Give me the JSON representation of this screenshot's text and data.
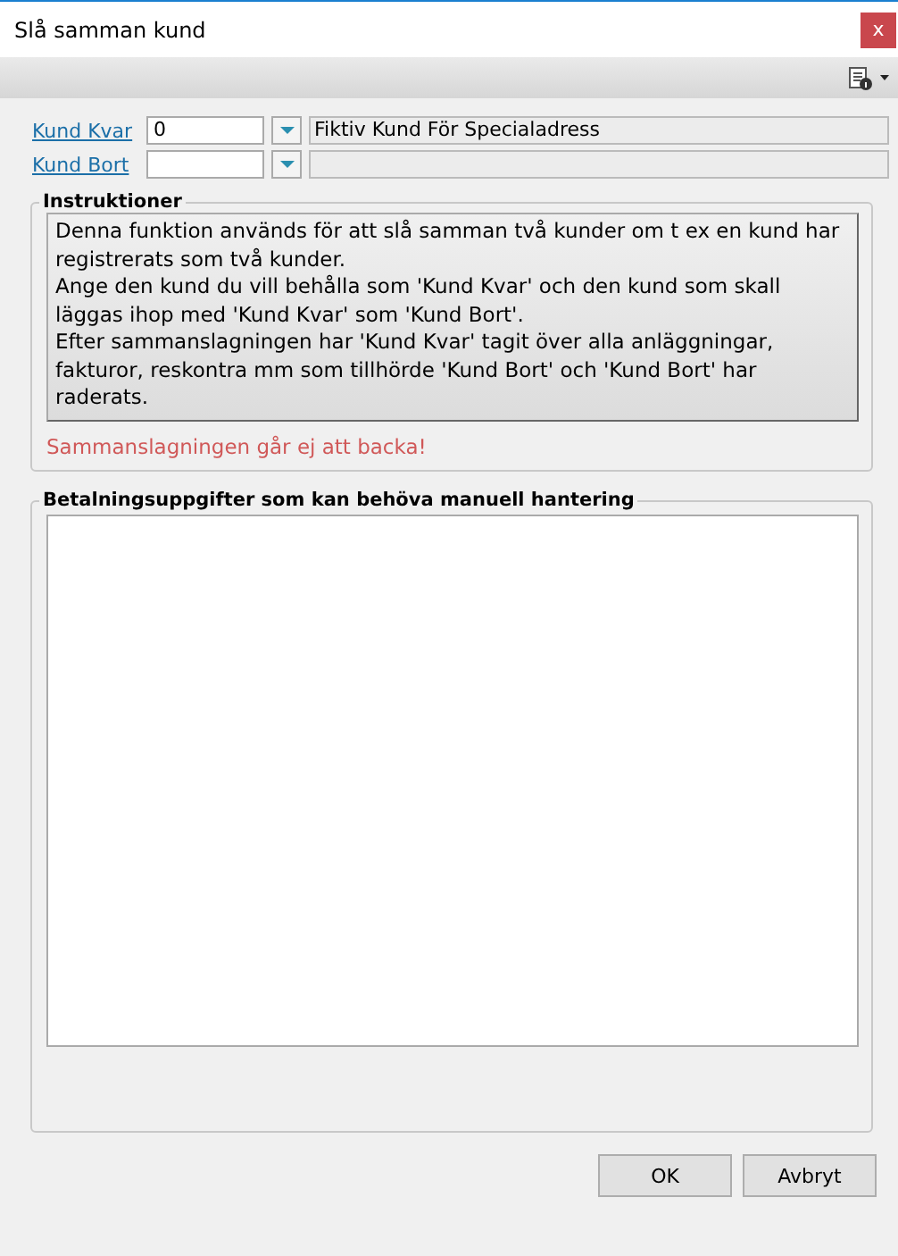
{
  "window": {
    "title": "Slå samman kund",
    "close": "x"
  },
  "fields": [
    {
      "label": "Kund Kvar",
      "value": "0",
      "name": "Fiktiv Kund För Specialadress"
    },
    {
      "label": "Kund Bort"
    }
  ],
  "instructions": {
    "title": "Instruktioner",
    "paragraphs": [
      "Denna funktion används för att slå samman två kunder om t ex en kund har registrerats som två kunder.",
      "Ange den kund du vill behålla som 'Kund Kvar' och den kund som skall läggas ihop med 'Kund Kvar' som 'Kund Bort'.",
      "Efter sammanslagningen har 'Kund Kvar' tagit över alla anläggningar, fakturor, reskontra mm som tillhörde 'Kund Bort' och 'Kund Bort' har raderats."
    ],
    "warning": "Sammanslagningen går ej att backa!"
  },
  "payments": {
    "title": "Betalningsuppgifter som kan behöva manuell hantering"
  },
  "buttons": [
    "OK",
    "Avbryt"
  ]
}
